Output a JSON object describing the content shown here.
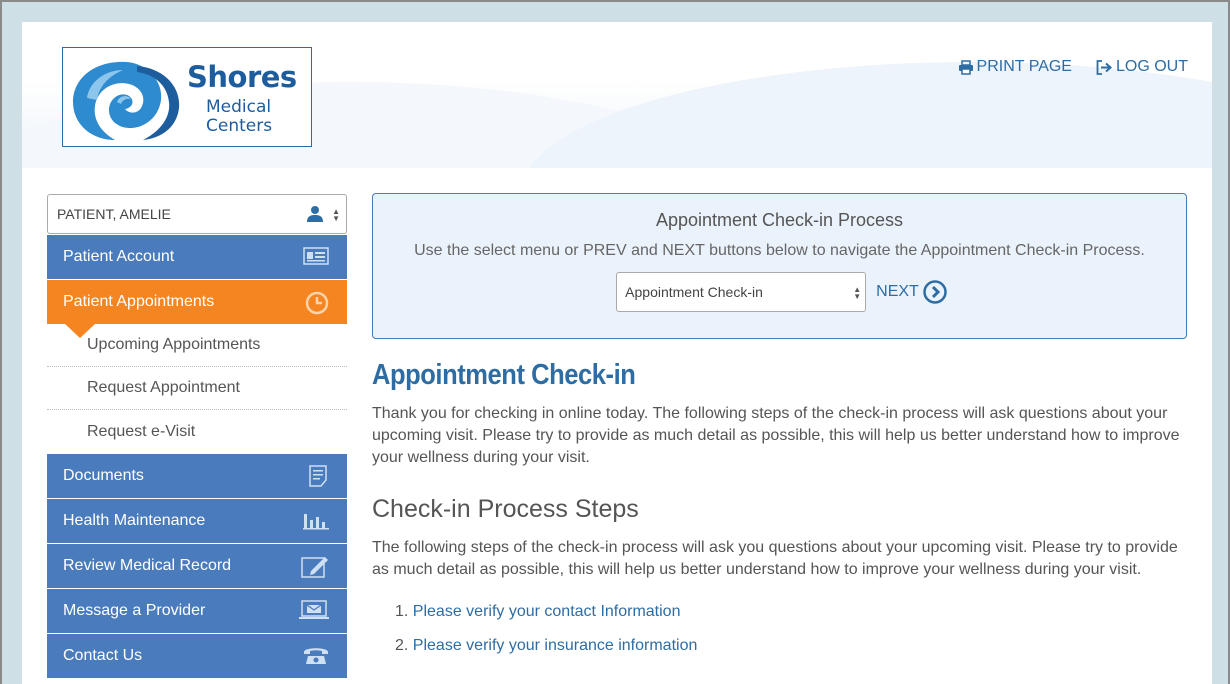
{
  "brand": {
    "name": "Shores",
    "line1": "Medical",
    "line2": "Centers",
    "colors": {
      "primary": "#1d5d9e",
      "wave": "#2e8bcf",
      "accent": "#f48521",
      "nav": "#4a7bbd"
    }
  },
  "header": {
    "print_label": "PRINT PAGE",
    "logout_label": "LOG OUT"
  },
  "sidebar": {
    "patient_select_value": "PATIENT, AMELIE",
    "nav": [
      {
        "label": "Patient Account",
        "icon": "id-card-icon"
      },
      {
        "label": "Patient Appointments",
        "icon": "clock-icon",
        "active": true
      },
      {
        "label": "Documents",
        "icon": "document-icon"
      },
      {
        "label": "Health Maintenance",
        "icon": "bar-chart-icon"
      },
      {
        "label": "Review Medical Record",
        "icon": "edit-record-icon"
      },
      {
        "label": "Message a Provider",
        "icon": "laptop-mail-icon"
      },
      {
        "label": "Contact Us",
        "icon": "phone-icon"
      }
    ],
    "subnav": [
      {
        "label": "Upcoming Appointments"
      },
      {
        "label": "Request Appointment"
      },
      {
        "label": "Request e-Visit"
      }
    ]
  },
  "process": {
    "title": "Appointment Check-in Process",
    "description": "Use the select menu or PREV and NEXT buttons below to navigate the Appointment Check-in Process.",
    "select_value": "Appointment Check-in",
    "next_label": "NEXT"
  },
  "content": {
    "heading": "Appointment Check-in",
    "intro": "Thank you for checking in online today. The following steps of the check-in process will ask questions about your upcoming visit. Please try to provide as much detail as possible, this will help us better understand how to improve your wellness during your visit.",
    "steps_heading": "Check-in Process Steps",
    "steps_intro": "The following steps of the check-in process will ask you questions about your upcoming visit. Please try to provide as much detail as possible, this will help us better understand how to improve your wellness during your visit.",
    "steps": [
      {
        "num": "1.",
        "label": "Please verify your contact Information"
      },
      {
        "num": "2.",
        "label": "Please verify your insurance information"
      }
    ]
  }
}
